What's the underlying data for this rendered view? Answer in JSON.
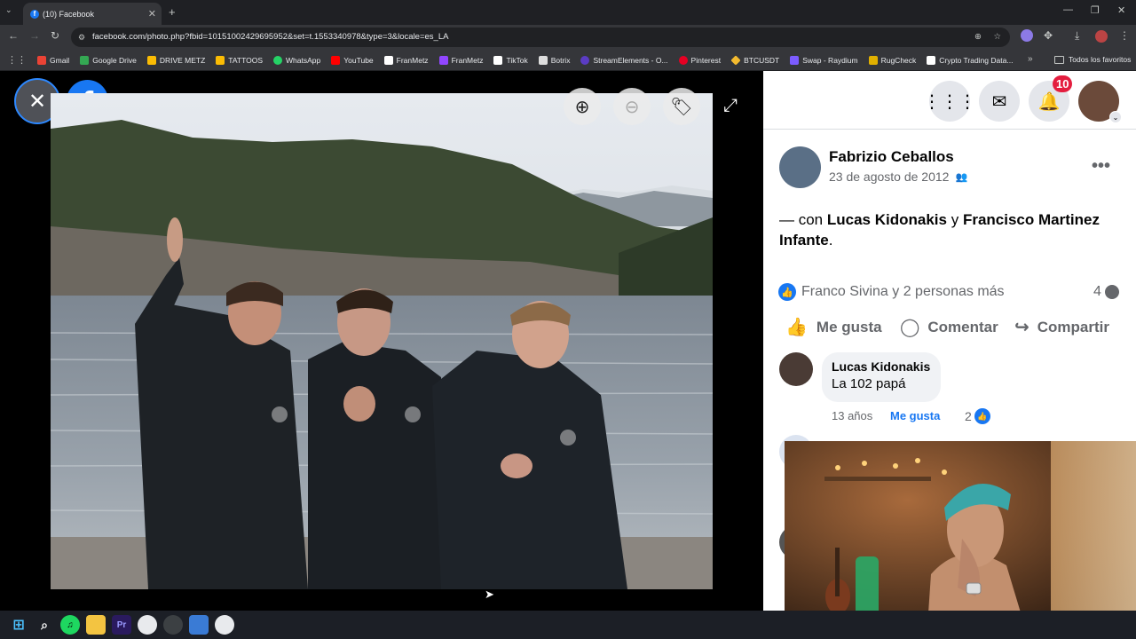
{
  "browser": {
    "tab_title": "(10) Facebook",
    "url": "facebook.com/photo.php?fbid=10151002429695952&set=t.1553340978&type=3&locale=es_LA",
    "bookmarks": [
      {
        "label": "Gmail",
        "color": "#ea4335"
      },
      {
        "label": "Google Drive",
        "color": "#34a853"
      },
      {
        "label": "DRIVE METZ",
        "color": "#fbbc04"
      },
      {
        "label": "TATTOOS",
        "color": "#fbbc04"
      },
      {
        "label": "WhatsApp",
        "color": "#25d366"
      },
      {
        "label": "YouTube",
        "color": "#ff0000"
      },
      {
        "label": "FranMetz",
        "color": "#ffffff"
      },
      {
        "label": "FranMetz",
        "color": "#9146ff"
      },
      {
        "label": "TikTok",
        "color": "#ffffff"
      },
      {
        "label": "Botrix",
        "color": "#dddddd"
      },
      {
        "label": "StreamElements - O...",
        "color": "#5b3cc4"
      },
      {
        "label": "Pinterest",
        "color": "#e60023"
      },
      {
        "label": "BTCUSDT",
        "color": "#f3ba2f"
      },
      {
        "label": "Swap - Raydium",
        "color": "#7c5cff"
      },
      {
        "label": "RugCheck",
        "color": "#e1b000"
      },
      {
        "label": "Crypto Trading Data...",
        "color": "#ffffff"
      }
    ],
    "all_bookmarks": "Todos los favoritos"
  },
  "header": {
    "notif_count": "10"
  },
  "post": {
    "author": "Fabrizio Ceballos",
    "date": "23 de agosto de 2012",
    "with_prefix": "— con",
    "tag1": "Lucas Kidonakis",
    "conj": "y",
    "tag2": "Francisco Martinez Infante",
    "period": ".",
    "reactions_text": "Franco Sivina y 2 personas más",
    "comment_count": "4",
    "actions": {
      "like": "Me gusta",
      "comment": "Comentar",
      "share": "Compartir"
    }
  },
  "comment": {
    "author": "Lucas Kidonakis",
    "text": "La 102 papá",
    "time": "13 años",
    "like": "Me gusta",
    "likes": "2"
  }
}
